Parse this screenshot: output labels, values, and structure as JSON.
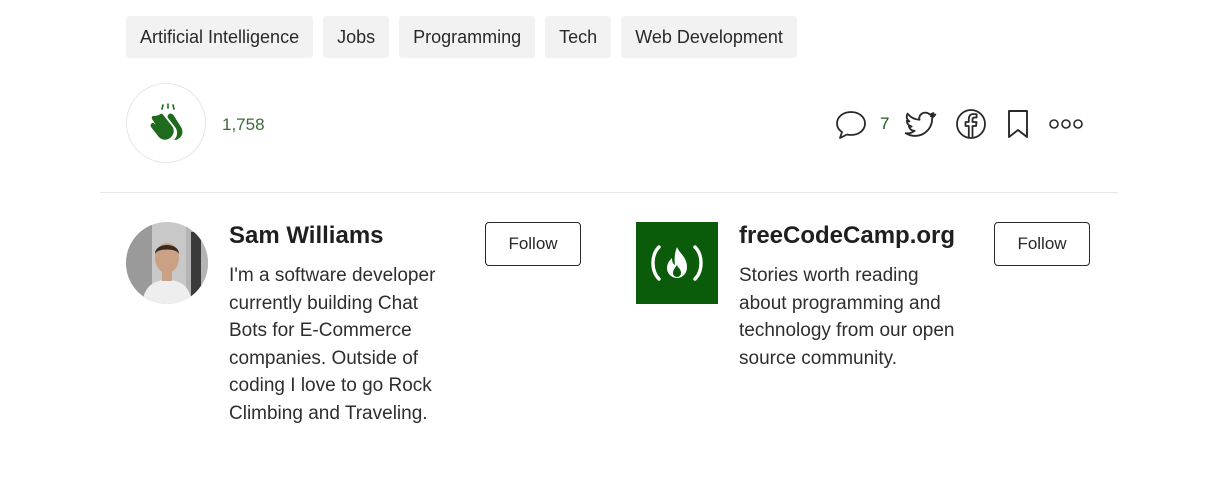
{
  "tags": [
    "Artificial Intelligence",
    "Jobs",
    "Programming",
    "Tech",
    "Web Development"
  ],
  "claps": {
    "count": "1,758"
  },
  "responses": {
    "count": "7"
  },
  "authors": [
    {
      "name": "Sam Williams",
      "bio": "I'm a software developer currently building Chat Bots for E-Commerce companies. Outside of coding I love to go Rock Climbing and Traveling.",
      "follow_label": "Follow"
    },
    {
      "name": "freeCodeCamp.org",
      "bio": "Stories worth reading about programming and technology from our open source community.",
      "follow_label": "Follow"
    }
  ],
  "colors": {
    "accent": "#0a5c0a",
    "clap_green": "#1e6b1e"
  },
  "icons": [
    "clap-icon",
    "response-icon",
    "twitter-icon",
    "facebook-icon",
    "bookmark-icon",
    "more-icon"
  ]
}
